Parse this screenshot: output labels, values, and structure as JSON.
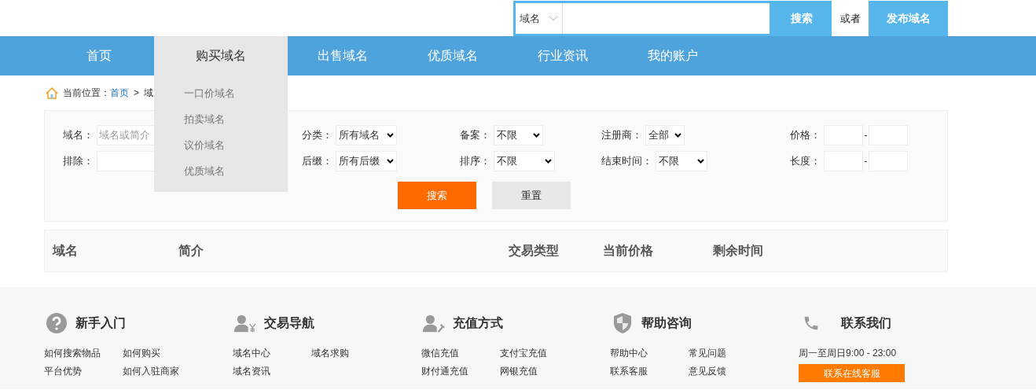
{
  "top_search": {
    "type_select": "域名",
    "button": "搜索",
    "or_text": "或者",
    "publish_button": "发布域名"
  },
  "nav": [
    {
      "label": "首页",
      "selected": false
    },
    {
      "label": "购买域名",
      "selected": true,
      "children": [
        "一口价域名",
        "拍卖域名",
        "议价域名",
        "优质域名"
      ]
    },
    {
      "label": "出售域名",
      "selected": false
    },
    {
      "label": "优质域名",
      "selected": false
    },
    {
      "label": "行业资讯",
      "selected": false
    },
    {
      "label": "我的账户",
      "selected": false
    }
  ],
  "breadcrumb": {
    "label": "当前位置：",
    "home": "首页",
    "separator": ">",
    "current": "域"
  },
  "filters": [
    [
      {
        "kind": "text",
        "label": "域名：",
        "placeholder": "域名或简介"
      },
      {
        "kind": "select",
        "label": "分类：",
        "value": "所有域名"
      },
      {
        "kind": "select",
        "label": "备案：",
        "value": "不限"
      },
      {
        "kind": "select",
        "label": "注册商：",
        "value": "全部"
      },
      {
        "kind": "range",
        "label": "价格：",
        "separator": "-"
      }
    ],
    [
      {
        "kind": "text",
        "label": "排除："
      },
      {
        "kind": "select",
        "label": "后缀：",
        "value": "所有后缀"
      },
      {
        "kind": "select",
        "label": "排序：",
        "value": "不限"
      },
      {
        "kind": "select",
        "label": "结束时间：",
        "value": "不限"
      },
      {
        "kind": "range",
        "label": "长度：",
        "separator": "-"
      }
    ]
  ],
  "filter_buttons": {
    "search": "搜索",
    "reset": "重置"
  },
  "table": {
    "columns": [
      "域名",
      "简介",
      "交易类型",
      "当前价格",
      "剩余时间"
    ]
  },
  "footer": [
    {
      "kind": "help",
      "title": "新手入门",
      "links": [
        "如何搜索物品",
        "如何购买",
        "平台优势",
        "如何入驻商家"
      ]
    },
    {
      "kind": "trade",
      "title": "交易导航",
      "links": [
        "域名中心",
        "域名求购",
        "域名资讯"
      ]
    },
    {
      "kind": "pay",
      "title": "充值方式",
      "links": [
        "微信充值",
        "支付宝充值",
        "财付通充值",
        "网银充值"
      ]
    },
    {
      "kind": "shield",
      "title": "帮助咨询",
      "links": [
        "帮助中心",
        "常见问题",
        "联系客服",
        "意见反馈"
      ]
    },
    {
      "kind": "phone",
      "title": "联系我们",
      "hours": "周一至周日9:00 - 23:00",
      "button": "联系在线客服"
    }
  ]
}
